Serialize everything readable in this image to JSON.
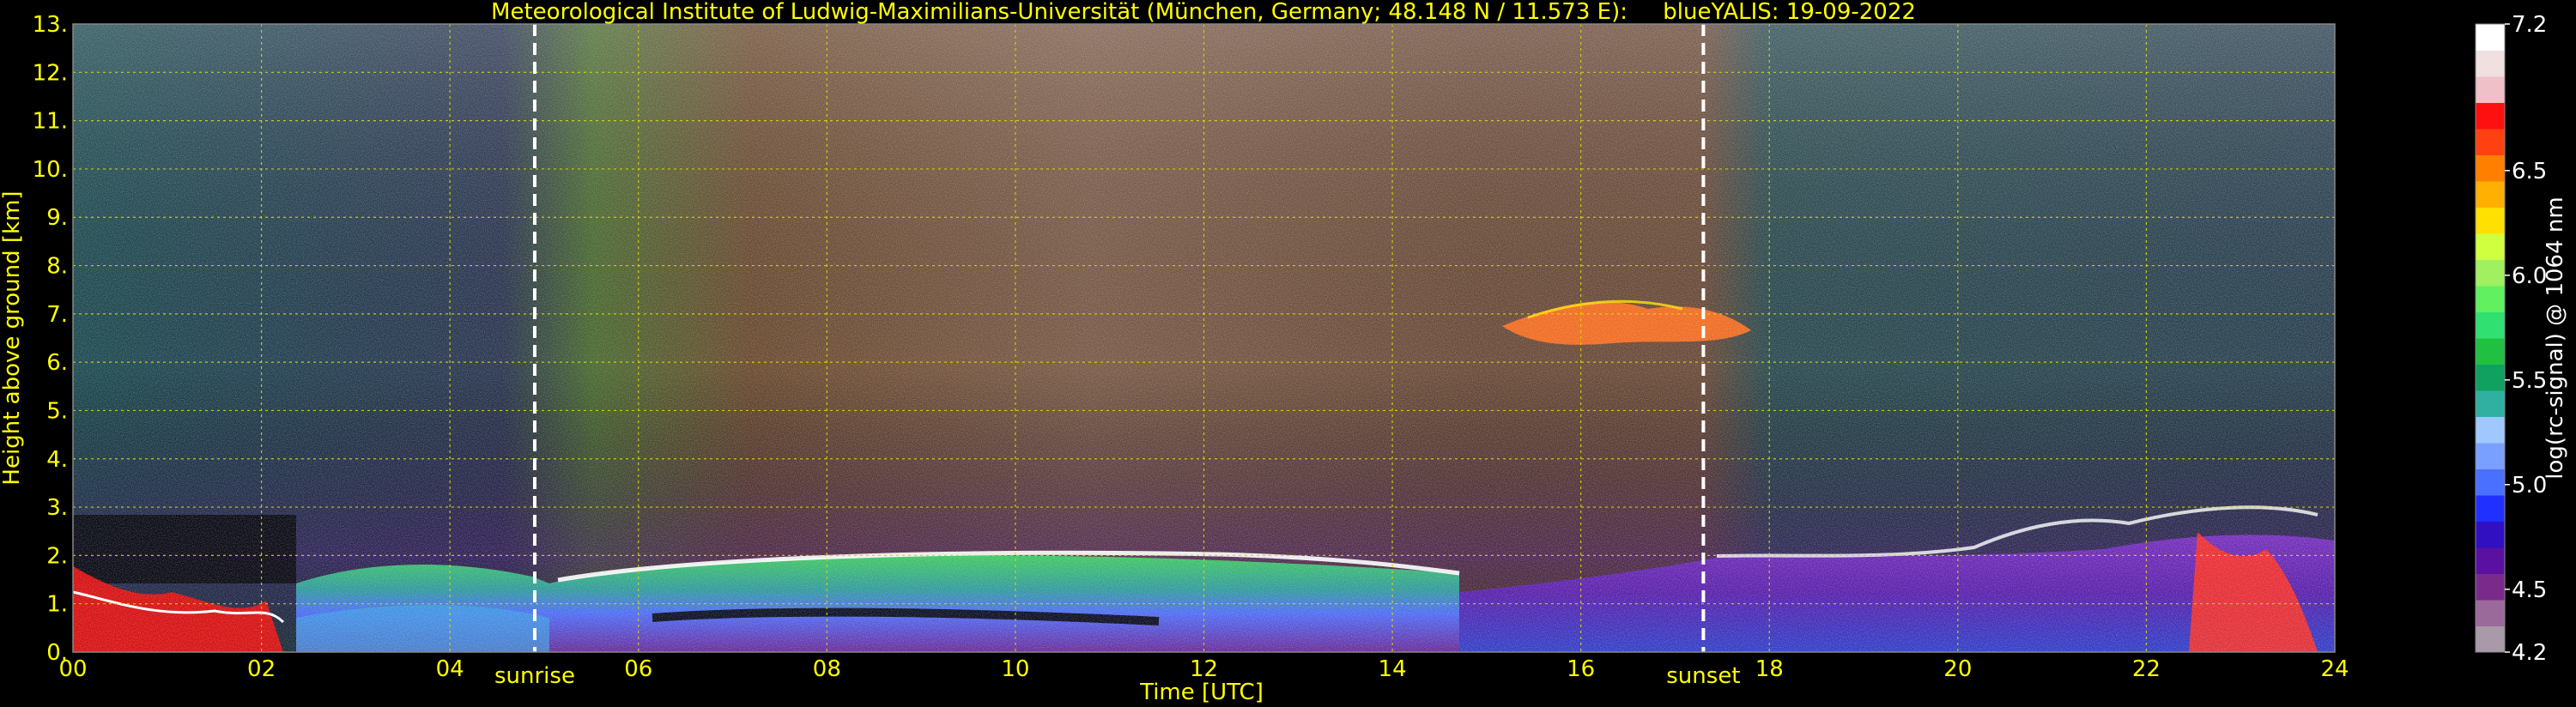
{
  "chart_data": {
    "type": "heatmap",
    "title": "Meteorological Institute of Ludwig-Maximilians-Universität (München, Germany; 48.148 N / 11.573 E):     blueYALIS: 19-09-2022",
    "xlabel": "Time [UTC]",
    "ylabel": "Height above ground [km]",
    "colorbar_label": "log(rc-signal) @ 1064 nm",
    "xlim": [
      0,
      24
    ],
    "ylim": [
      0,
      13
    ],
    "x_ticks": [
      "00",
      "02",
      "04",
      "06",
      "08",
      "10",
      "12",
      "14",
      "16",
      "18",
      "20",
      "22",
      "24"
    ],
    "y_ticks": [
      "0.",
      "1.",
      "2.",
      "3.",
      "4.",
      "5.",
      "6.",
      "7.",
      "8.",
      "9.",
      "10.",
      "11.",
      "12.",
      "13."
    ],
    "colorbar_range": [
      4.2,
      7.2
    ],
    "colorbar_ticks": [
      "4.2",
      "4.5",
      "5.0",
      "5.5",
      "6.0",
      "6.5",
      "7.2"
    ],
    "colorbar_tick_values": [
      4.2,
      4.5,
      5.0,
      5.5,
      6.0,
      6.5,
      7.2
    ],
    "grid": true,
    "annotations": [
      {
        "label": "sunrise",
        "x": 4.9
      },
      {
        "label": "sunset",
        "x": 17.3
      }
    ]
  },
  "colors": {
    "background": "#000000",
    "text": "#ffff00",
    "grid": "#d8d800",
    "colorbar_text": "#ffffff",
    "colormap": [
      "#a89aa8",
      "#9a6a9a",
      "#7a2a8a",
      "#5a10a0",
      "#3010c0",
      "#2030ff",
      "#4a70ff",
      "#7aa0ff",
      "#a0c8ff",
      "#30b0a0",
      "#10a060",
      "#20c040",
      "#30e070",
      "#60f060",
      "#a0f060",
      "#d0ff40",
      "#ffe000",
      "#ffb000",
      "#ff8000",
      "#ff4010",
      "#ff1010",
      "#f0c0c8",
      "#f0e0e0",
      "#ffffff"
    ]
  }
}
